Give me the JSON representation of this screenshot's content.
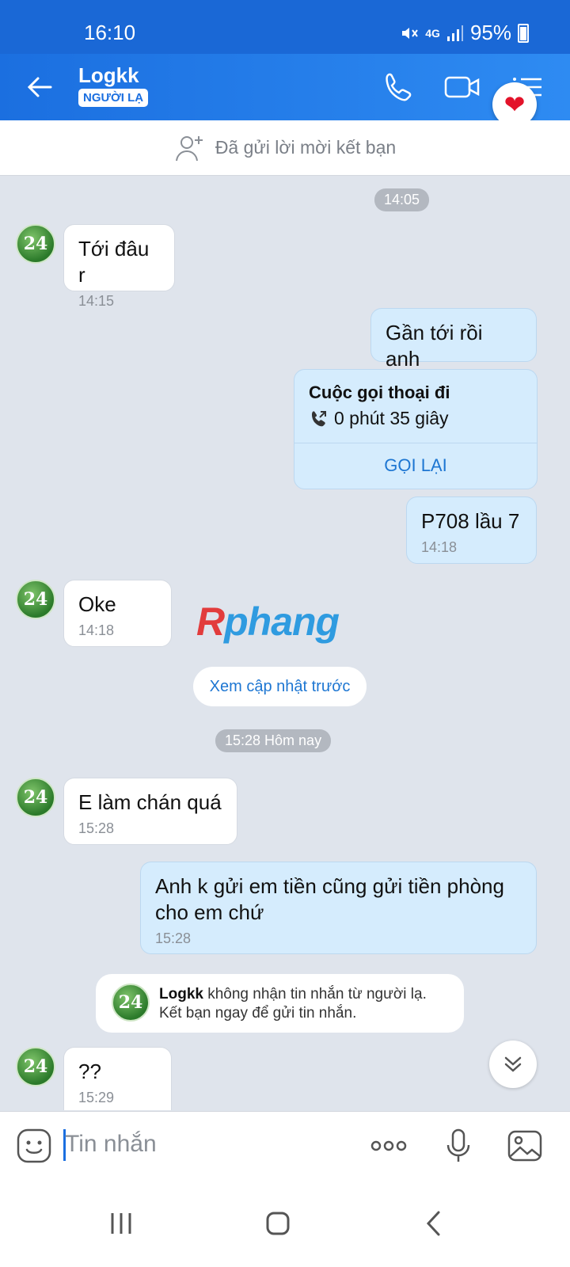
{
  "status": {
    "time": "16:10",
    "network": "4G",
    "battery": "95%"
  },
  "header": {
    "name": "Logkk",
    "badge": "NGƯỜI LẠ"
  },
  "friend_bar": {
    "text": "Đã gửi lời mời kết bạn"
  },
  "avatar_text": "24",
  "time_pills": {
    "first": "14:05",
    "today": "15:28 Hôm nay"
  },
  "messages": [
    {
      "text": "Tới đâu r",
      "time": "14:15"
    },
    {
      "text": "Gần tới rồi anh"
    },
    {
      "text": "P708 lầu 7",
      "time": "14:18"
    },
    {
      "text": "Oke",
      "time": "14:18"
    },
    {
      "text": "E làm chán quá",
      "time": "15:28"
    },
    {
      "text": "Anh k gửi em tiền cũng gửi tiền phòng cho em chứ",
      "time": "15:28"
    },
    {
      "text": "??",
      "time": "15:29"
    }
  ],
  "call_card": {
    "title": "Cuộc gọi thoại đi",
    "duration": "0 phút 35 giây",
    "action": "GỌI LẠI"
  },
  "watermark": {
    "first": "R",
    "rest": "phang"
  },
  "see_previous": "Xem cập nhật trước",
  "notice": {
    "name": "Logkk",
    "line1": " không nhận tin nhắn từ người lạ.",
    "line2": "Kết bạn ngay để gửi tin nhắn."
  },
  "input": {
    "placeholder": "Tin nhắn"
  },
  "colors": {
    "header": "#1b6fe0",
    "my_bubble": "#d5ecfd",
    "background": "#dfe4ec",
    "link": "#1d76d2"
  }
}
